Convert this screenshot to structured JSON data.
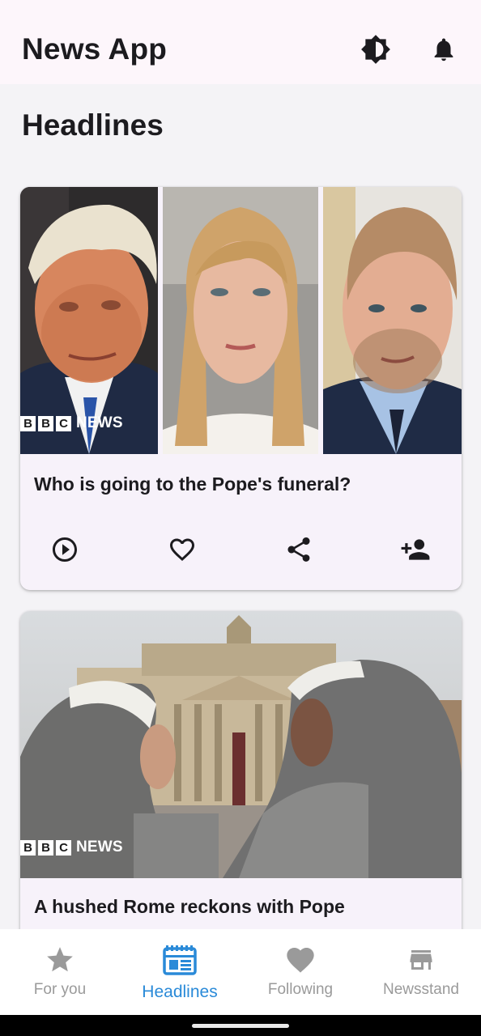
{
  "app_bar": {
    "title": "News App",
    "actions": [
      {
        "name": "brightness-icon"
      },
      {
        "name": "bell-icon"
      }
    ]
  },
  "section": {
    "title": "Headlines"
  },
  "articles": [
    {
      "source_logo": {
        "letters": [
          "B",
          "B",
          "C"
        ],
        "word": "NEWS"
      },
      "headline": "Who is going to the Pope's funeral?",
      "actions": [
        "play-circle-icon",
        "heart-outline-icon",
        "share-icon",
        "person-add-icon"
      ]
    },
    {
      "source_logo": {
        "letters": [
          "B",
          "B",
          "C"
        ],
        "word": "NEWS"
      },
      "headline": "A hushed Rome reckons with Pope"
    }
  ],
  "bottom_nav": {
    "items": [
      {
        "label": "For you",
        "icon": "star-icon",
        "active": false
      },
      {
        "label": "Headlines",
        "icon": "headlines-icon",
        "active": true
      },
      {
        "label": "Following",
        "icon": "heart-icon",
        "active": false
      },
      {
        "label": "Newsstand",
        "icon": "storefront-icon",
        "active": false
      }
    ]
  },
  "colors": {
    "app_bar_bg": "#fdf6fb",
    "card_bg": "#f7f2fa",
    "active_nav": "#2a8ad8",
    "inactive_nav": "#9a9a9a"
  }
}
